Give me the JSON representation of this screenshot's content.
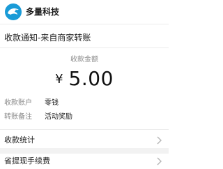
{
  "header": {
    "app_name": "多量科技",
    "logo_icon": "dolphin-logo-icon",
    "brand_color": "#1a9bd7"
  },
  "notice": {
    "title": "收款通知-来自商家转账",
    "amount_label": "收款金额",
    "currency_symbol": "¥",
    "amount": "5.00",
    "details": [
      {
        "label": "收款账户",
        "value": "零钱"
      },
      {
        "label": "转账备注",
        "value": "活动奖励"
      }
    ]
  },
  "menu": {
    "items": [
      {
        "label": "收款统计",
        "icon": "chevron-right-icon"
      },
      {
        "label": "省提现手续费",
        "icon": "chevron-right-icon"
      }
    ]
  }
}
